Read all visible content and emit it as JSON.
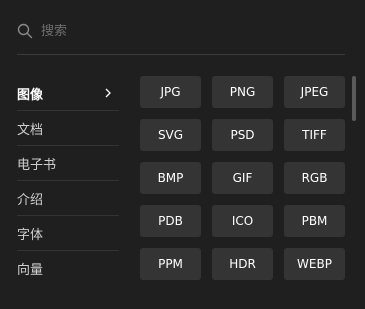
{
  "search": {
    "placeholder": "搜索",
    "value": ""
  },
  "sidebar": {
    "items": [
      {
        "label": "图像",
        "active": true
      },
      {
        "label": "文档",
        "active": false
      },
      {
        "label": "电子书",
        "active": false
      },
      {
        "label": "介绍",
        "active": false
      },
      {
        "label": "字体",
        "active": false
      },
      {
        "label": "向量",
        "active": false
      }
    ]
  },
  "formats": [
    "JPG",
    "PNG",
    "JPEG",
    "SVG",
    "PSD",
    "TIFF",
    "BMP",
    "GIF",
    "RGB",
    "PDB",
    "ICO",
    "PBM",
    "PPM",
    "HDR",
    "WEBP"
  ],
  "colors": {
    "background": "#1f1f1f",
    "button": "#343434",
    "divider": "#3a3a3a",
    "text": "#ffffff",
    "muted_text": "#6e6e6e"
  },
  "icons": {
    "search": "search-icon",
    "chevron": "chevron-right-icon"
  }
}
